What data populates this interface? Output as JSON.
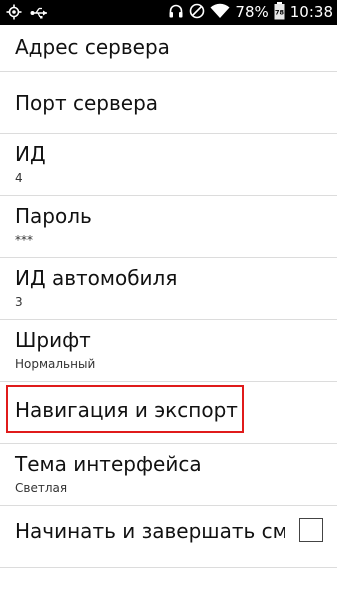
{
  "status_bar": {
    "icons_left": [
      "gps-icon",
      "usb-icon"
    ],
    "icons_right": [
      "headset-icon",
      "no-sim-icon",
      "wifi-icon",
      "battery-icon"
    ],
    "battery_percent": "78%",
    "time": "10:38"
  },
  "preferences": [
    {
      "title": "Адрес сервера",
      "summary": ""
    },
    {
      "title": "Порт сервера",
      "summary": ""
    },
    {
      "title": "ИД",
      "summary": "4"
    },
    {
      "title": "Пароль",
      "summary": "***"
    },
    {
      "title": "ИД автомобиля",
      "summary": "3"
    },
    {
      "title": "Шрифт",
      "summary": "Нормальный"
    },
    {
      "title": "Навигация и экспорт",
      "summary": "",
      "highlighted": true
    },
    {
      "title": "Тема интерфейса",
      "summary": "Светлая"
    },
    {
      "title": "Начинать и завершать смену",
      "summary": "",
      "checkbox": true,
      "checked": false
    }
  ],
  "colors": {
    "highlight": "#e01b1b",
    "status_bar_bg": "#000000",
    "background": "#ffffff",
    "divider": "#dcdcdc"
  }
}
